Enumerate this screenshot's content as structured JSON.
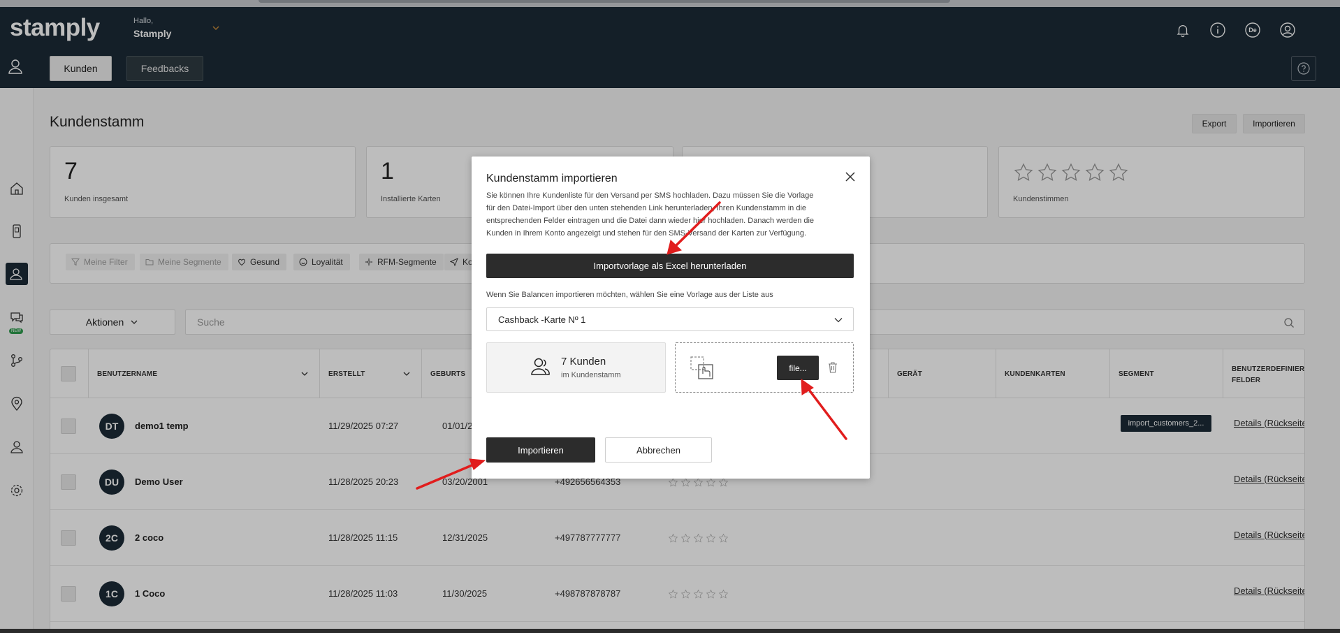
{
  "header": {
    "logo": "stamply",
    "greeting": "Hallo,",
    "user_name": "Stamply",
    "language_badge": "De",
    "icons": [
      "bell-icon",
      "info-icon",
      "language-icon",
      "account-icon",
      "help-icon"
    ]
  },
  "tabs": [
    {
      "label": "Kunden",
      "active": true
    },
    {
      "label": "Feedbacks",
      "active": false
    }
  ],
  "sidebar": {
    "new_badge": "NEW",
    "items": [
      "home-icon",
      "wallet-icon",
      "customers-icon",
      "chat-icon",
      "flow-icon",
      "location-icon",
      "user-icon",
      "settings-icon"
    ]
  },
  "page": {
    "title": "Kundenstamm",
    "export_label": "Export",
    "import_label": "Importieren"
  },
  "stats": [
    {
      "value": "7",
      "label": "Kunden insgesamt"
    },
    {
      "value": "1",
      "label": "Installierte Karten"
    },
    {
      "value": "",
      "label": ""
    },
    {
      "value": "",
      "label": "Kundenstimmen",
      "stars_filled": 0,
      "stars_total": 5
    }
  ],
  "filters": [
    {
      "label": "Meine Filter",
      "icon": "filter-icon",
      "dim": true
    },
    {
      "label": "Meine Segmente",
      "icon": "folder-icon",
      "dim": true
    },
    {
      "label": "Gesund",
      "icon": "heart-icon",
      "dim": false
    },
    {
      "label": "Loyalität",
      "icon": "smile-icon",
      "dim": false
    },
    {
      "label": "RFM-Segmente",
      "icon": "rfm-icon",
      "dim": false
    },
    {
      "label": "Ko",
      "icon": "send-icon",
      "dim": false
    }
  ],
  "toolbar": {
    "actions_label": "Aktionen",
    "search_placeholder": "Suche"
  },
  "table": {
    "columns": [
      "BENUTZERNAME",
      "ERSTELLT",
      "GEBURTS",
      "GERÄT",
      "KUNDENKARTEN",
      "SEGMENT",
      "BENUTZERDEFINIERTE FELDER"
    ],
    "rows": [
      {
        "initials": "DT",
        "name": "demo1 temp",
        "created": "11/29/2025 07:27",
        "birthday": "01/01/2",
        "phone": "",
        "segment": "import_customers_2...",
        "details": "Details (Rückseite"
      },
      {
        "initials": "DU",
        "name": "Demo User",
        "created": "11/28/2025 20:23",
        "birthday": "03/20/2001",
        "phone": "+492656564353",
        "segment": "",
        "details": "Details (Rückseite"
      },
      {
        "initials": "2C",
        "name": "2 coco",
        "created": "11/28/2025 11:15",
        "birthday": "12/31/2025",
        "phone": "+497787777777",
        "segment": "",
        "details": "Details (Rückseite"
      },
      {
        "initials": "1C",
        "name": "1 Coco",
        "created": "11/28/2025 11:03",
        "birthday": "11/30/2025",
        "phone": "+498787878787",
        "segment": "",
        "details": "Details (Rückseite"
      }
    ]
  },
  "modal": {
    "title": "Kundenstamm importieren",
    "description": "Sie können Ihre Kundenliste für den Versand per SMS hochladen. Dazu müssen Sie die Vorlage für den Datei-Import über den unten stehenden Link herunterladen, Ihren Kundenstamm in die entsprechenden Felder eintragen und die Datei dann wieder hier hochladen. Danach werden die Kunden in Ihrem Konto angezeigt und stehen für den SMS-Versand der Karten zur Verfügung.",
    "download_button": "Importvorlage als Excel herunterladen",
    "balance_hint": "Wenn Sie Balancen importieren möchten, wählen Sie eine Vorlage aus der Liste aus",
    "template_select": "Cashback -Karte Nº 1",
    "customer_count": "7 Kunden",
    "customer_count_sub": "im Kundenstamm",
    "file_button": "file...",
    "import_button": "Importieren",
    "cancel_button": "Abbrechen"
  },
  "colors": {
    "header_bg": "#1c2b36",
    "dark_button": "#2c2c2c",
    "annotation_arrow": "#e11d1d"
  }
}
